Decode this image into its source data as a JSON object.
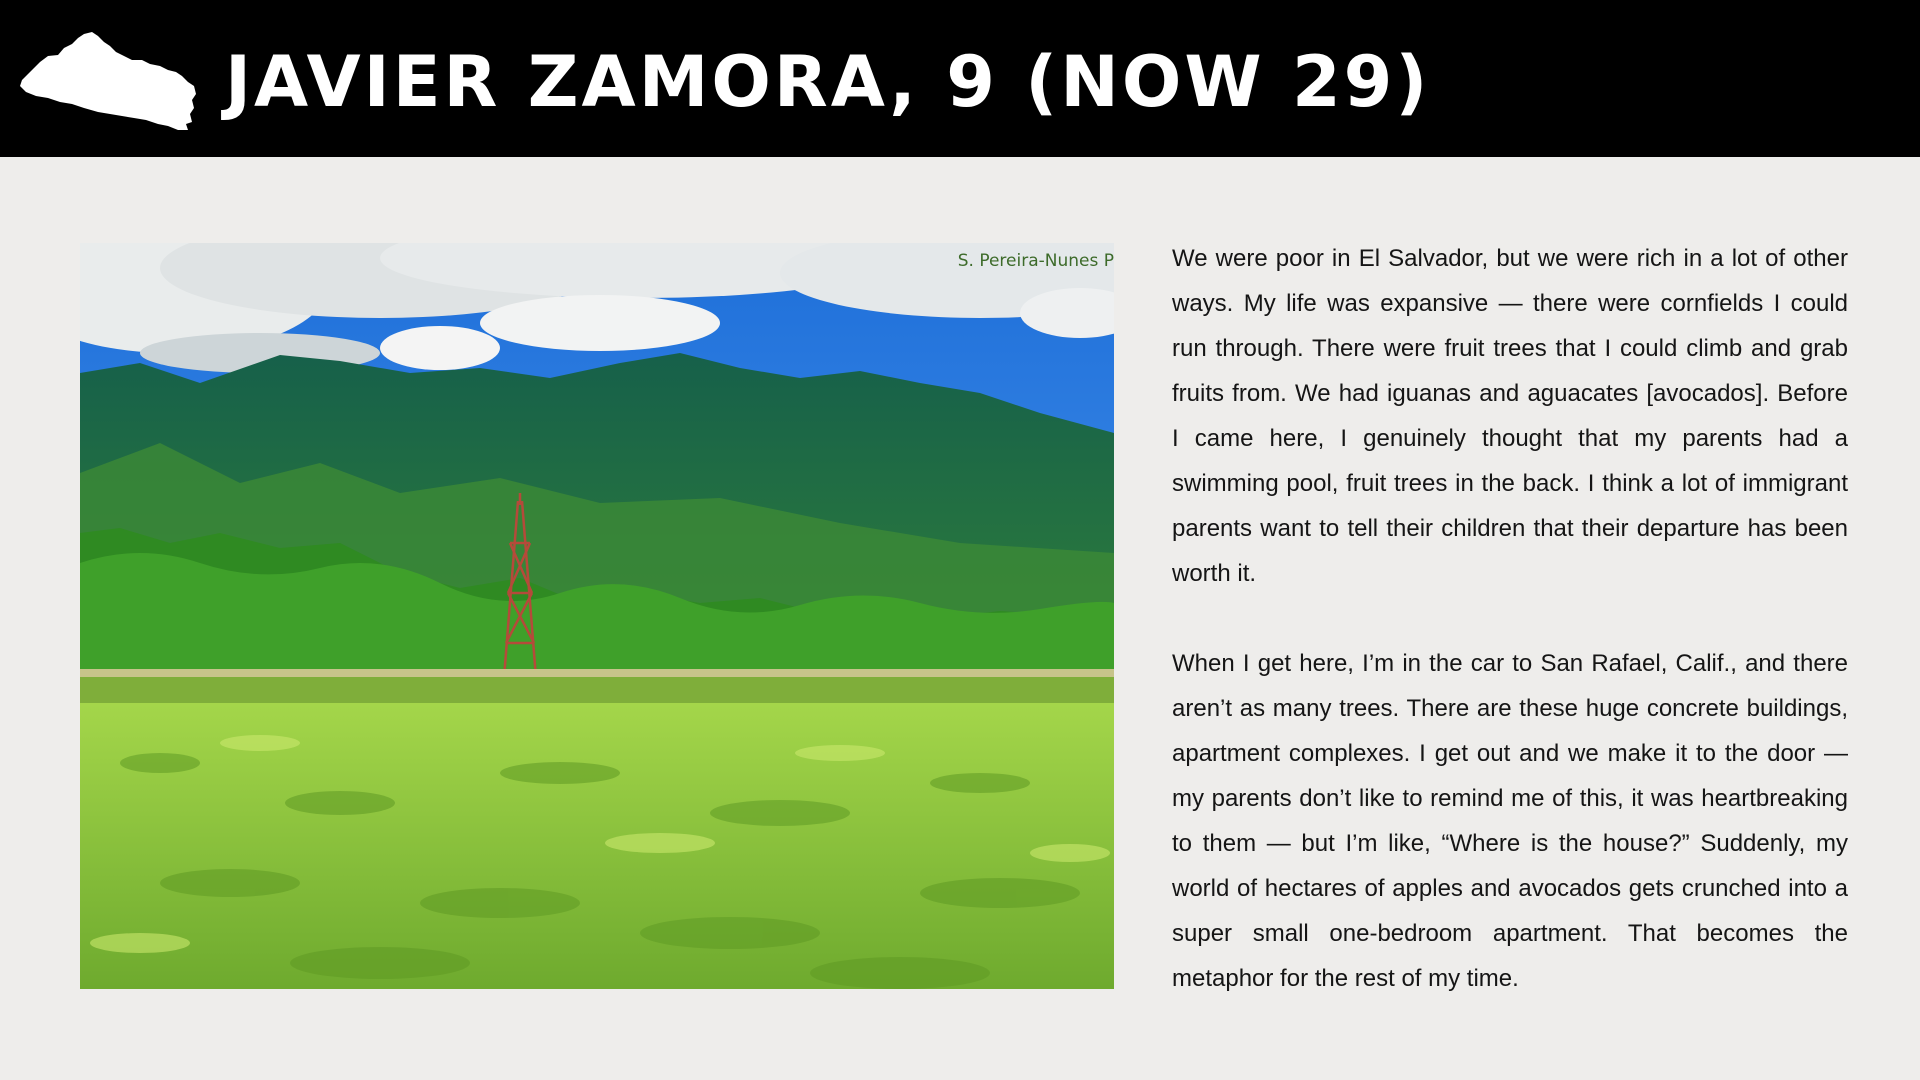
{
  "header": {
    "title": "JAVIER ZAMORA, 9 (NOW 29)",
    "icon": "el-salvador-map-icon"
  },
  "photo": {
    "credit": "S. Pereira-Nunes P",
    "subject": "farm-field-photo"
  },
  "story": {
    "paragraphs": [
      "We were poor in El Salvador, but we were rich in a lot of other ways. My life was expansive — there were cornfields I could run through. There were fruit trees that I could climb and grab fruits from. We had iguanas and aguacates [avocados]. Before I came here, I genuinely thought that my parents had a swimming pool, fruit trees in the back. I think a lot of immigrant parents want to tell their children that their departure has been worth it.",
      "When I get here, I’m in the car to San Rafael, Calif., and there aren’t as many trees. There are these huge concrete buildings, apartment complexes. I get out and we make it to the door — my parents don’t like to remind me of this, it was heartbreaking to them — but I’m like, “Where is the house?” Suddenly, my world of hectares of apples and avocados gets crunched into a super small one-bedroom apartment. That becomes the metaphor for the rest of my time."
    ]
  },
  "colors": {
    "header_bg": "#000000",
    "header_text": "#ffffff",
    "page_bg": "#eeedeb",
    "body_text": "#151515"
  }
}
